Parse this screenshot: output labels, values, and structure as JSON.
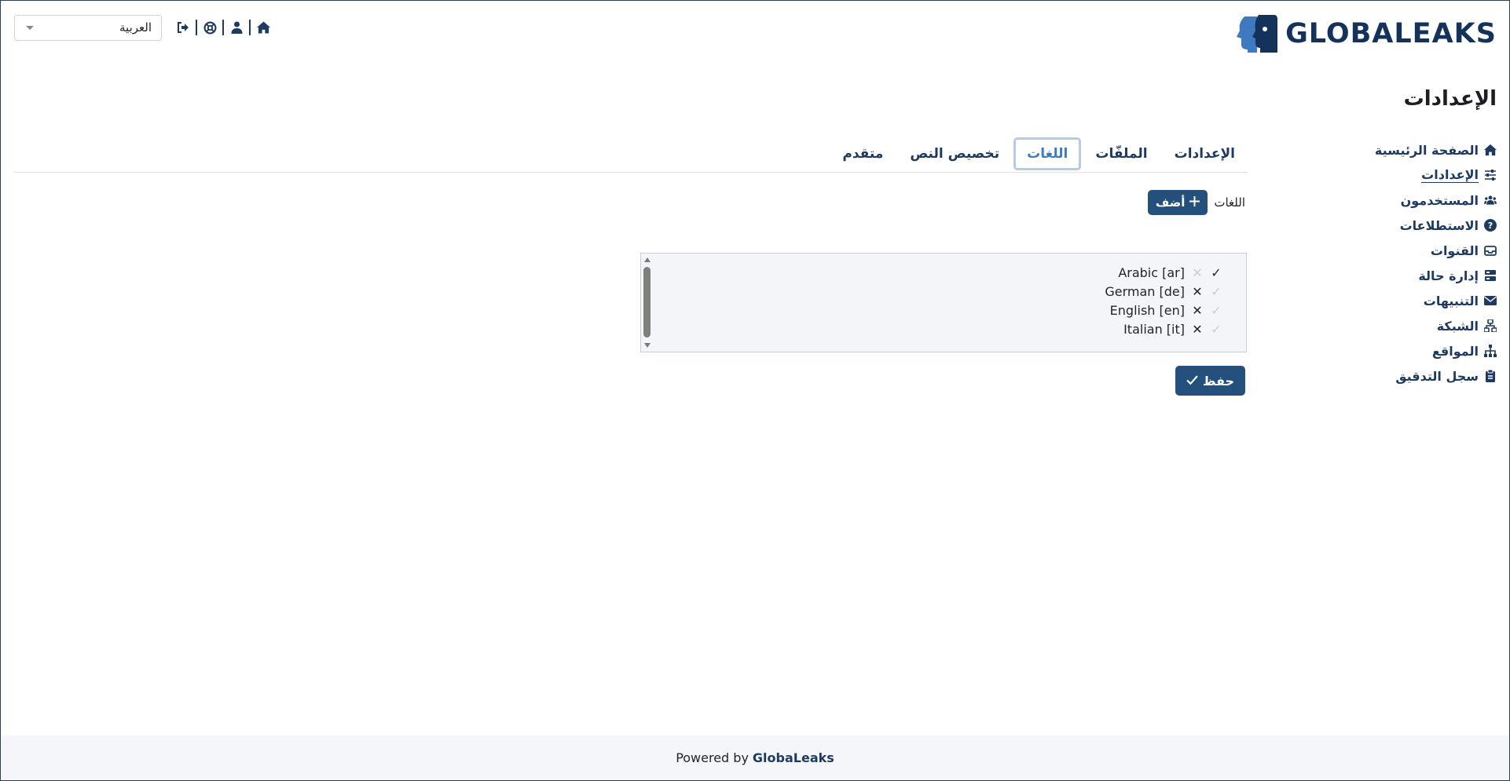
{
  "header": {
    "brand": "GLOBALEAKS",
    "language_select": {
      "value": "العربية"
    },
    "icons": [
      "logout-icon",
      "help-icon",
      "user-icon",
      "home-icon"
    ]
  },
  "page": {
    "title": "الإعدادات"
  },
  "sidebar": {
    "items": [
      {
        "label": "الصفحة الرئيسية",
        "icon": "home-icon"
      },
      {
        "label": "الإعدادات",
        "icon": "sliders-icon",
        "active": true
      },
      {
        "label": "المستخدمون",
        "icon": "users-icon"
      },
      {
        "label": "الاستطلاعات",
        "icon": "question-icon"
      },
      {
        "label": "القنوات",
        "icon": "inbox-icon"
      },
      {
        "label": "إدارة حالة",
        "icon": "server-icon"
      },
      {
        "label": "التنبيهات",
        "icon": "envelope-icon"
      },
      {
        "label": "الشبكة",
        "icon": "network-icon"
      },
      {
        "label": "المواقع",
        "icon": "sitemap-icon"
      },
      {
        "label": "سجل التدقيق",
        "icon": "clipboard-icon"
      }
    ]
  },
  "tabs": [
    {
      "label": "الإعدادات"
    },
    {
      "label": "الملفّات"
    },
    {
      "label": "اللغات",
      "active": true
    },
    {
      "label": "تخصيص النص"
    },
    {
      "label": "متقدم"
    }
  ],
  "languages": {
    "label": "اللغات",
    "add_label": "أضف",
    "items": [
      {
        "name": "Arabic [ar]",
        "default": true,
        "removable": false
      },
      {
        "name": "German [de]",
        "default": false,
        "removable": true
      },
      {
        "name": "English [en]",
        "default": false,
        "removable": true
      },
      {
        "name": "Italian [it]",
        "default": false,
        "removable": true
      }
    ]
  },
  "save_label": "حفظ",
  "footer": {
    "prefix": "Powered by",
    "brand": "GlobaLeaks"
  },
  "colors": {
    "primary": "#23507d",
    "accent": "#3f7ac1",
    "brand": "#14325a"
  }
}
